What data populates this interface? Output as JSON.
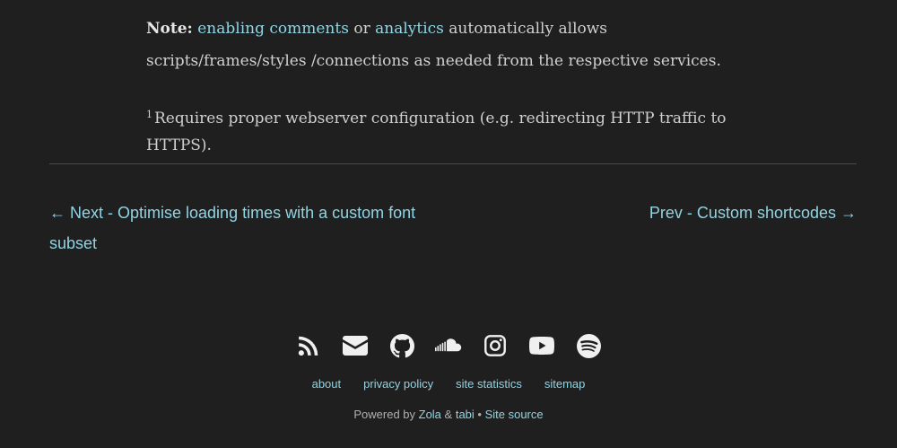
{
  "note": {
    "label": "Note:",
    "link1": "enabling comments",
    "between": " or ",
    "link2": "analytics",
    "rest": " automatically allows scripts/frames/styles /connections as needed from the respective services."
  },
  "footnote": {
    "marker": "1",
    "text": "Requires proper webserver configuration (e.g. redirecting HTTP traffic to HTTPS)."
  },
  "post_nav": {
    "next": "← Next - Optimise loading times with a custom font subset",
    "prev": "Prev - Custom shortcodes →"
  },
  "socials": [
    "rss-icon",
    "email-icon",
    "github-icon",
    "soundcloud-icon",
    "instagram-icon",
    "youtube-icon",
    "spotify-icon"
  ],
  "footer_links": {
    "about": "about",
    "privacy": "privacy policy",
    "stats": "site statistics",
    "sitemap": "sitemap"
  },
  "powered": {
    "prefix": "Powered by ",
    "zola": "Zola",
    "amp": " & ",
    "tabi": "tabi",
    "bullet": " • ",
    "source": "Site source"
  },
  "colors": {
    "background": "#1f1f1f",
    "link": "#91d4e3",
    "text": "#d0d0d0"
  }
}
